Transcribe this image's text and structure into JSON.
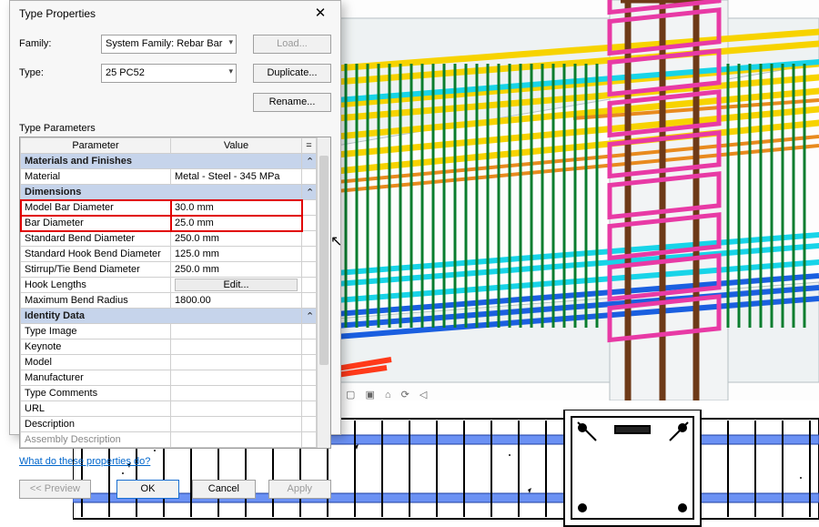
{
  "dialog": {
    "title": "Type Properties",
    "family": {
      "label": "Family:",
      "value": "System Family: Rebar Bar"
    },
    "type": {
      "label": "Type:",
      "value": "25 PC52"
    },
    "buttons": {
      "load": "Load...",
      "duplicate": "Duplicate...",
      "rename": "Rename..."
    },
    "type_params_label": "Type Parameters",
    "grid": {
      "param_header": "Parameter",
      "value_header": "Value",
      "eq_header": "=",
      "sections": [
        {
          "title": "Materials and Finishes",
          "rows": [
            {
              "name": "Material",
              "value": "Metal - Steel - 345 MPa"
            }
          ]
        },
        {
          "title": "Dimensions",
          "rows": [
            {
              "name": "Model Bar Diameter",
              "value": "30.0 mm",
              "hl": true
            },
            {
              "name": "Bar Diameter",
              "value": "25.0 mm",
              "hl": true
            },
            {
              "name": "Standard Bend Diameter",
              "value": "250.0 mm"
            },
            {
              "name": "Standard Hook Bend Diameter",
              "value": "125.0 mm"
            },
            {
              "name": "Stirrup/Tie Bend Diameter",
              "value": "250.0 mm"
            },
            {
              "name": "Hook Lengths",
              "value": "Edit...",
              "editbtn": true
            },
            {
              "name": "Maximum Bend Radius",
              "value": "1800.00"
            }
          ]
        },
        {
          "title": "Identity Data",
          "rows": [
            {
              "name": "Type Image",
              "value": ""
            },
            {
              "name": "Keynote",
              "value": ""
            },
            {
              "name": "Model",
              "value": ""
            },
            {
              "name": "Manufacturer",
              "value": ""
            },
            {
              "name": "Type Comments",
              "value": ""
            },
            {
              "name": "URL",
              "value": ""
            },
            {
              "name": "Description",
              "value": ""
            },
            {
              "name": "Assembly Description",
              "value": "",
              "grey": true
            }
          ]
        }
      ]
    },
    "help_link": "What do these properties do?",
    "footer": {
      "preview": "<< Preview",
      "ok": "OK",
      "cancel": "Cancel",
      "apply": "Apply"
    }
  }
}
